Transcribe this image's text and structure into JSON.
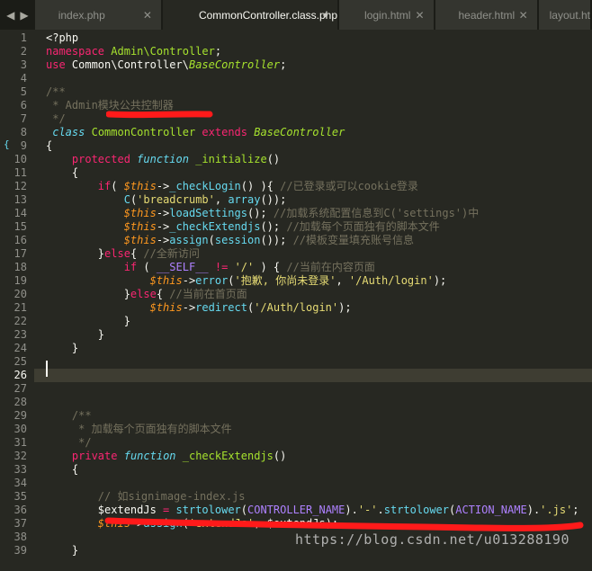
{
  "tabs": [
    {
      "label": "index.php",
      "active": false,
      "close": "✕"
    },
    {
      "label": "CommonController.class.php",
      "active": true,
      "close": "●"
    },
    {
      "label": "login.html",
      "active": false,
      "close": "✕"
    },
    {
      "label": "header.html",
      "active": false,
      "close": "✕"
    },
    {
      "label": "layout.ht",
      "active": false,
      "close": ""
    }
  ],
  "nav": {
    "back": "◀",
    "forward": "▶"
  },
  "current_line": 26,
  "line_numbers": [
    "1",
    "2",
    "3",
    "4",
    "5",
    "6",
    "7",
    "8",
    "9",
    "10",
    "11",
    "12",
    "13",
    "14",
    "15",
    "16",
    "17",
    "18",
    "19",
    "20",
    "21",
    "22",
    "23",
    "24",
    "25",
    "26",
    "27",
    "28",
    "29",
    "30",
    "31",
    "32",
    "33",
    "34",
    "35",
    "36",
    "37",
    "38",
    "39"
  ],
  "code": [
    [
      [
        "",
        "<?php"
      ]
    ],
    [
      [
        "k",
        "namespace"
      ],
      [
        "",
        " "
      ],
      [
        "t",
        "Admin\\Controller"
      ],
      [
        "",
        ";"
      ]
    ],
    [
      [
        "k",
        "use"
      ],
      [
        "",
        " Common\\Controller\\"
      ],
      [
        "ti",
        "BaseController"
      ],
      [
        "",
        ";"
      ]
    ],
    [],
    [
      [
        "c",
        "/**"
      ]
    ],
    [
      [
        "c",
        " * Admin模块公共控制器"
      ]
    ],
    [
      [
        "c",
        " */"
      ]
    ],
    [
      [
        "bi",
        " class"
      ],
      [
        "",
        " "
      ],
      [
        "t",
        "CommonController"
      ],
      [
        "",
        " "
      ],
      [
        "k",
        "extends"
      ],
      [
        "",
        " "
      ],
      [
        "ti",
        "BaseController"
      ]
    ],
    [
      [
        "",
        "{"
      ]
    ],
    [
      [
        "",
        "    "
      ],
      [
        "k",
        "protected"
      ],
      [
        "",
        " "
      ],
      [
        "bi",
        "function"
      ],
      [
        "",
        " "
      ],
      [
        "f",
        "_initialize"
      ],
      [
        "",
        "()"
      ]
    ],
    [
      [
        "",
        "    {"
      ]
    ],
    [
      [
        "",
        "        "
      ],
      [
        "k",
        "if"
      ],
      [
        "",
        "( "
      ],
      [
        "v",
        "$this"
      ],
      [
        "",
        "->"
      ],
      [
        "b",
        "_checkLogin"
      ],
      [
        "",
        "() ){ "
      ],
      [
        "c",
        "//已登录或可以cookie登录"
      ]
    ],
    [
      [
        "",
        "            "
      ],
      [
        "b",
        "C"
      ],
      [
        "",
        "("
      ],
      [
        "s",
        "'breadcrumb'"
      ],
      [
        "",
        ", "
      ],
      [
        "b",
        "array"
      ],
      [
        "",
        "());"
      ]
    ],
    [
      [
        "",
        "            "
      ],
      [
        "v",
        "$this"
      ],
      [
        "",
        "->"
      ],
      [
        "b",
        "loadSettings"
      ],
      [
        "",
        "(); "
      ],
      [
        "c",
        "//加载系统配置信息到C('settings')中"
      ]
    ],
    [
      [
        "",
        "            "
      ],
      [
        "v",
        "$this"
      ],
      [
        "",
        "->"
      ],
      [
        "b",
        "_checkExtendjs"
      ],
      [
        "",
        "(); "
      ],
      [
        "c",
        "//加载每个页面独有的脚本文件"
      ]
    ],
    [
      [
        "",
        "            "
      ],
      [
        "v",
        "$this"
      ],
      [
        "",
        "->"
      ],
      [
        "b",
        "assign"
      ],
      [
        "",
        "("
      ],
      [
        "b",
        "session"
      ],
      [
        "",
        "()); "
      ],
      [
        "c",
        "//模板变量填充账号信息"
      ]
    ],
    [
      [
        "",
        "        }"
      ],
      [
        "k",
        "else"
      ],
      [
        "",
        "{ "
      ],
      [
        "c",
        "//全新访问"
      ]
    ],
    [
      [
        "",
        "            "
      ],
      [
        "k",
        "if"
      ],
      [
        "",
        " ( "
      ],
      [
        "sc",
        "__SELF__"
      ],
      [
        "",
        " "
      ],
      [
        "k",
        "!="
      ],
      [
        "",
        " "
      ],
      [
        "s",
        "'/'"
      ],
      [
        "",
        " ) { "
      ],
      [
        "c",
        "//当前在内容页面"
      ]
    ],
    [
      [
        "",
        "                "
      ],
      [
        "v",
        "$this"
      ],
      [
        "",
        "->"
      ],
      [
        "b",
        "error"
      ],
      [
        "",
        "("
      ],
      [
        "s",
        "'抱歉, 你尚未登录'"
      ],
      [
        "",
        ", "
      ],
      [
        "s",
        "'/Auth/login'"
      ],
      [
        "",
        ");"
      ]
    ],
    [
      [
        "",
        "            }"
      ],
      [
        "k",
        "else"
      ],
      [
        "",
        "{ "
      ],
      [
        "c",
        "//当前在首页面"
      ]
    ],
    [
      [
        "",
        "                "
      ],
      [
        "v",
        "$this"
      ],
      [
        "",
        "->"
      ],
      [
        "b",
        "redirect"
      ],
      [
        "",
        "("
      ],
      [
        "s",
        "'/Auth/login'"
      ],
      [
        "",
        ");"
      ]
    ],
    [
      [
        "",
        "            }"
      ]
    ],
    [
      [
        "",
        "        }"
      ]
    ],
    [
      [
        "",
        "    }"
      ]
    ],
    [],
    [],
    [],
    [],
    [
      [
        "",
        "    "
      ],
      [
        "c",
        "/**"
      ]
    ],
    [
      [
        "",
        "    "
      ],
      [
        "c",
        " * 加载每个页面独有的脚本文件"
      ]
    ],
    [
      [
        "",
        "    "
      ],
      [
        "c",
        " */"
      ]
    ],
    [
      [
        "",
        "    "
      ],
      [
        "k",
        "private"
      ],
      [
        "",
        " "
      ],
      [
        "bi",
        "function"
      ],
      [
        "",
        " "
      ],
      [
        "f",
        "_checkExtendjs"
      ],
      [
        "",
        "()"
      ]
    ],
    [
      [
        "",
        "    {"
      ]
    ],
    [],
    [
      [
        "",
        "        "
      ],
      [
        "c",
        "// 如signimage-index.js"
      ]
    ],
    [
      [
        "",
        "        $extendJs "
      ],
      [
        "k",
        "="
      ],
      [
        "",
        " "
      ],
      [
        "b",
        "strtolower"
      ],
      [
        "",
        "("
      ],
      [
        "sc",
        "CONTROLLER_NAME"
      ],
      [
        "",
        ")."
      ],
      [
        "s",
        "'-'"
      ],
      [
        "",
        "."
      ],
      [
        "b",
        "strtolower"
      ],
      [
        "",
        "("
      ],
      [
        "sc",
        "ACTION_NAME"
      ],
      [
        "",
        ")."
      ],
      [
        "s",
        "'.js'"
      ],
      [
        "",
        ";"
      ]
    ],
    [
      [
        "",
        "        "
      ],
      [
        "v",
        "$this"
      ],
      [
        "",
        "->"
      ],
      [
        "b",
        "assign"
      ],
      [
        "",
        "("
      ],
      [
        "s",
        "'extendJs'"
      ],
      [
        "",
        ", $extendJs);"
      ]
    ],
    [],
    [
      [
        "",
        "    }"
      ]
    ],
    []
  ],
  "watermark": "https://blog.csdn.net/u013288190",
  "colors": {
    "background": "#272822",
    "tabbar": "#1b1c17",
    "annotation": "#ff0000"
  }
}
